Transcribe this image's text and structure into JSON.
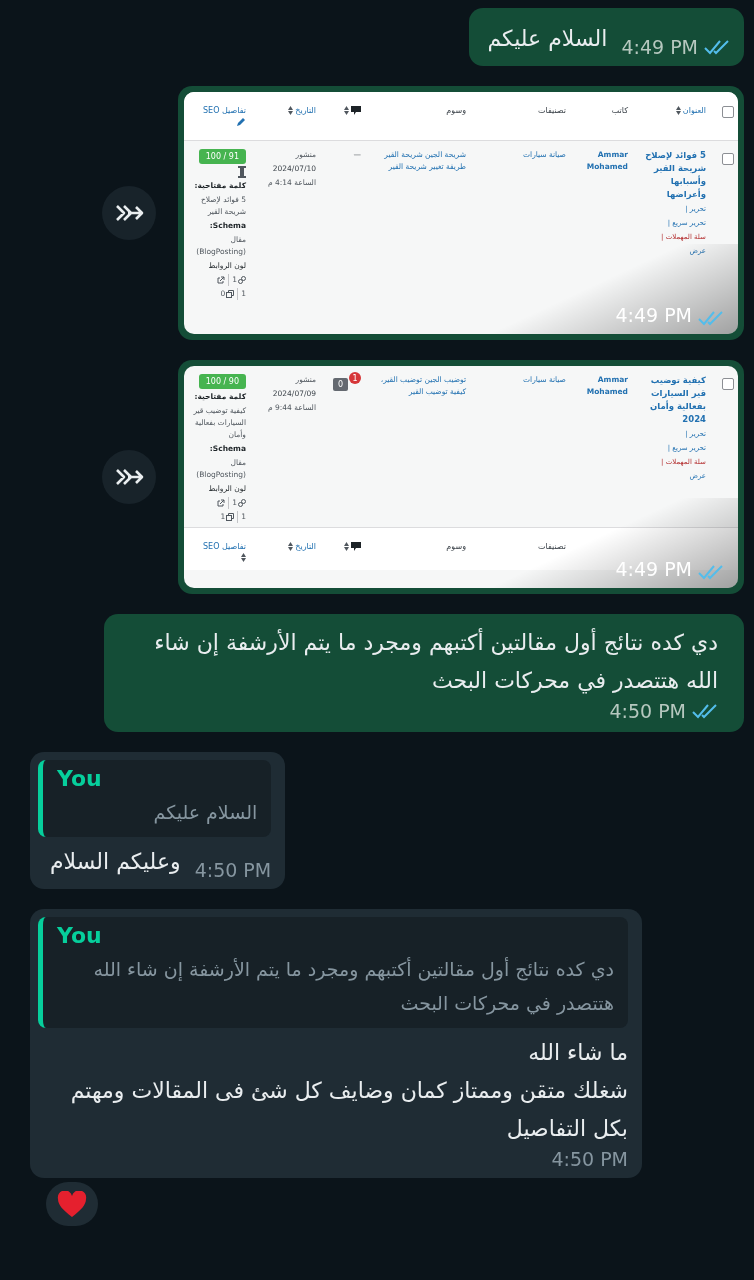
{
  "messages": [
    {
      "kind": "text",
      "outgoing": true,
      "text": "السلام عليكم",
      "time": "4:49 PM",
      "read": true
    },
    {
      "kind": "image",
      "outgoing": true,
      "forward_button": true,
      "time": "4:49 PM",
      "read": true,
      "table": {
        "header_columns": [
          {
            "kind": "checkbox",
            "checked": false
          },
          {
            "kind": "title",
            "label": "العنوان",
            "sortable": true
          },
          {
            "kind": "author",
            "label": "كاتب"
          },
          {
            "kind": "categories",
            "label": "تصنيفات"
          },
          {
            "kind": "tags",
            "label": "وسوم"
          },
          {
            "kind": "comments",
            "sortable": true
          },
          {
            "kind": "date",
            "label": "التاريخ",
            "sortable": true
          },
          {
            "kind": "seo",
            "label": "تفاصيل SEO",
            "edit_icon": true
          }
        ],
        "row": {
          "checked": false,
          "title": "5 فوائد لإصلاح شريحة القير وأسبابها وأعراضها",
          "actions": [
            {
              "label": "تحرير |",
              "kind": "link"
            },
            {
              "label": "تحرير سريع |",
              "kind": "link"
            },
            {
              "label": "سلة المهملات |",
              "kind": "trash"
            },
            {
              "label": "عرض",
              "kind": "link"
            }
          ],
          "author": "Ammar Mohamed",
          "category": "صيانة سيارات",
          "tags": "شريحة الجين شريحة القير طريقة تغيير شريحة القير",
          "comments": {
            "kind": "dash",
            "text": "—"
          },
          "date": {
            "status": "منشور",
            "date": "2024/07/10",
            "time": "الساعة 4:14 م"
          },
          "seo": {
            "score": "100 / 91",
            "pillar": true,
            "keyword_label": "كلمة مفتاحية:",
            "keyword": "5 فوائد لإصلاح شريحة القير",
            "schema_label": "Schema:",
            "schema": "مقال (BlogPosting)",
            "links_label": "لون الروابط",
            "link_lines": [
              [
                "1"
              ],
              [
                "1",
                "0"
              ]
            ]
          }
        }
      }
    },
    {
      "kind": "image",
      "outgoing": true,
      "forward_button": true,
      "time": "4:49 PM",
      "read": true,
      "table": {
        "row": {
          "checked": false,
          "title": "كيفية توضيب قير السيارات بفعالية وأمان 2024",
          "actions": [
            {
              "label": "تحرير |",
              "kind": "link"
            },
            {
              "label": "تحرير سريع |",
              "kind": "link"
            },
            {
              "label": "سلة المهملات |",
              "kind": "trash"
            },
            {
              "label": "عرض",
              "kind": "link"
            }
          ],
          "author": "Ammar Mohamed",
          "category": "صيانة سيارات",
          "tags": "توضيب الجين توضيب القير، كيفية توضيب القير",
          "comments": {
            "kind": "bubble",
            "count": "0",
            "pending": "1"
          },
          "date": {
            "status": "منشور",
            "date": "2024/07/09",
            "time": "الساعة 9:44 م"
          },
          "seo": {
            "score": "100 / 90",
            "keyword_label": "كلمة مفتاحية:",
            "keyword": "كيفية توضيب قير السيارات بفعالية وأمان",
            "schema_label": "Schema:",
            "schema": "مقال (BlogPosting)",
            "links_label": "لون الروابط",
            "link_lines": [
              [
                "1"
              ],
              [
                "1",
                "1"
              ]
            ]
          }
        },
        "footer_columns": [
          {
            "kind": "categories",
            "label": "تصنيفات"
          },
          {
            "kind": "tags",
            "label": "وسوم"
          },
          {
            "kind": "comments",
            "sortable": true
          },
          {
            "kind": "date",
            "label": "التاريخ",
            "sortable": true
          },
          {
            "kind": "seo",
            "label": "تفاصيل SEO",
            "sortable": true
          }
        ]
      }
    },
    {
      "kind": "text",
      "outgoing": true,
      "text": "دي كده نتائج أول مقالتين أكتبهم ومجرد ما يتم الأرشفة إن شاء الله هتتصدر في محركات البحث",
      "time": "4:50 PM",
      "read": true
    },
    {
      "kind": "reply",
      "outgoing": false,
      "quote": {
        "author": "You",
        "text": "السلام عليكم"
      },
      "text": "وعليكم السلام",
      "time": "4:50 PM"
    },
    {
      "kind": "reply",
      "outgoing": false,
      "quote": {
        "author": "You",
        "text": "دي كده نتائج أول مقالتين أكتبهم ومجرد ما يتم الأرشفة إن شاء الله هتتصدر في محركات البحث"
      },
      "text": "ما شاء الله\nشغلك متقن وممتاز كمان وضايف كل شئ فى المقالات ومهتم بكل التفاصيل",
      "time": "4:50 PM",
      "reaction": {
        "kind": "heart"
      }
    }
  ]
}
